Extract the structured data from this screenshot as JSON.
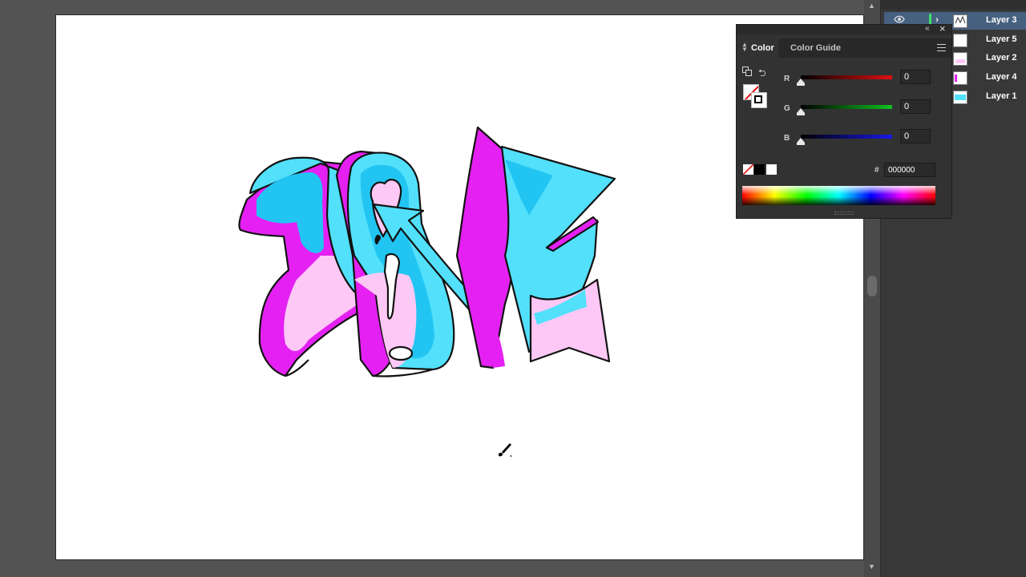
{
  "layers": [
    {
      "name": "Layer 3",
      "selected": true
    },
    {
      "name": "Layer 5",
      "selected": false
    },
    {
      "name": "Layer 2",
      "selected": false
    },
    {
      "name": "Layer 4",
      "selected": false
    },
    {
      "name": "Layer 1",
      "selected": false
    }
  ],
  "color_panel": {
    "tabs": {
      "color": "Color",
      "guide": "Color Guide"
    },
    "channels": [
      {
        "label": "R",
        "value": "0"
      },
      {
        "label": "G",
        "value": "0"
      },
      {
        "label": "B",
        "value": "0"
      }
    ],
    "hash": "#",
    "hex": "000000"
  },
  "colors": {
    "cyan": "#52e0fb",
    "cyan_dark": "#22c5f2",
    "magenta": "#e421f2",
    "pink": "#fdc8f5",
    "red_track": "#e01010",
    "green_track": "#10c020",
    "blue_track": "#1818e8"
  }
}
